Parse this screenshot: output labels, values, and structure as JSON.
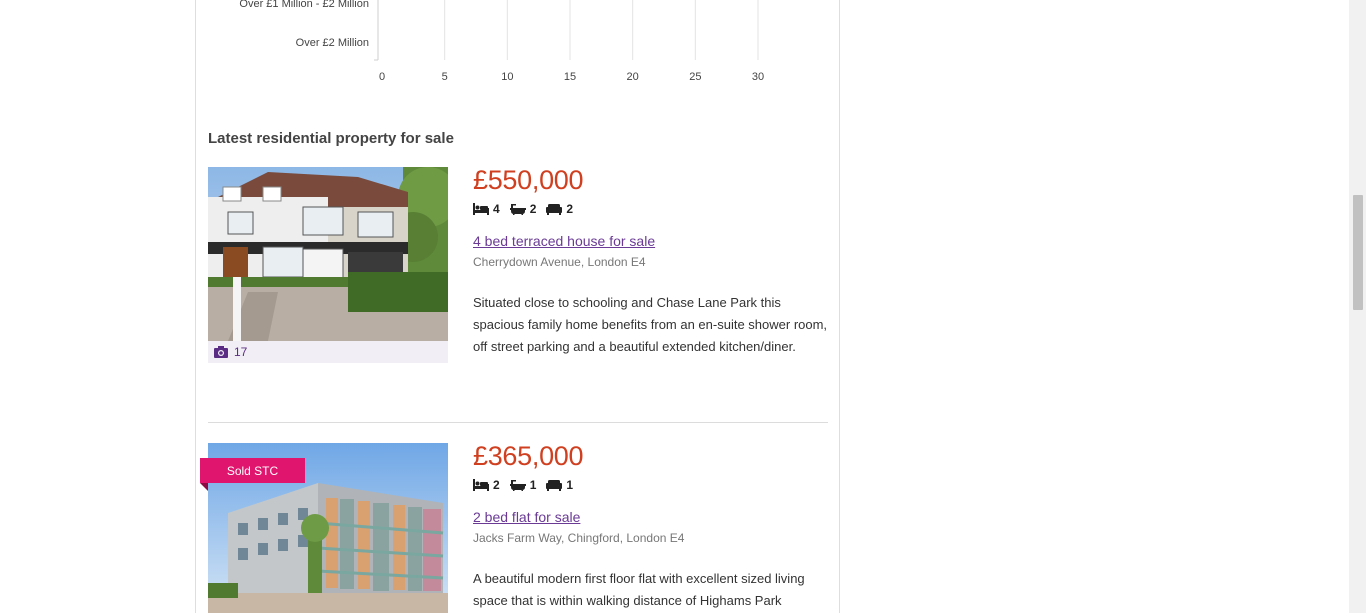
{
  "chart_data": {
    "type": "bar",
    "orientation": "horizontal",
    "categories": [
      "Over £1 Million - £2 Million",
      "Over £2 Million"
    ],
    "values": [
      0,
      0
    ],
    "x_ticks": [
      "0",
      "5",
      "10",
      "15",
      "20",
      "25",
      "30"
    ],
    "xlim": [
      0,
      30
    ],
    "grid": true
  },
  "section_title": "Latest residential property for sale",
  "listings": [
    {
      "price": "£550,000",
      "beds": "4",
      "baths": "2",
      "receptions": "2",
      "title": "4 bed terraced house for sale",
      "address": "Cherrydown Avenue, London E4",
      "description": "Situated close to schooling and Chase Lane Park this spacious family home benefits from an en-suite shower room, off street parking and a beautiful extended kitchen/diner.",
      "photo_count": "17",
      "badge": ""
    },
    {
      "price": "£365,000",
      "beds": "2",
      "baths": "1",
      "receptions": "1",
      "title": "2 bed flat for sale",
      "address": "Jacks Farm Way, Chingford, London E4",
      "description": "A beautiful modern first floor flat with excellent sized living space that is within walking distance of Highams Park",
      "photo_count": "",
      "badge": "Sold STC"
    }
  ],
  "icons": {
    "bed": "bed-icon",
    "bath": "bath-icon",
    "reception": "sofa-icon",
    "camera": "camera-icon"
  },
  "colors": {
    "price": "#d04020",
    "link": "#6a3a95",
    "badge": "#e0156d"
  }
}
